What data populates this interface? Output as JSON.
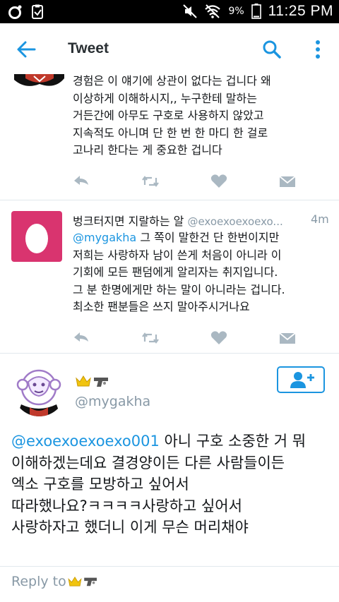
{
  "status_bar": {
    "battery_percent": "9%",
    "time": "11:25 PM"
  },
  "app_bar": {
    "title": "Tweet"
  },
  "tweet1": {
    "lines": [
      "경험은 이 얘기에 상관이 없다는 겁니다 왜",
      "이상하게 이해하시지,, 누구한테 말하는",
      "거든간에 아무도 구호로 사용하지 않았고",
      "지속적도 아니며 단 한 번 한 마디 한 걸로",
      "고나리 한다는 게 중요한 겁니다"
    ]
  },
  "tweet2": {
    "author_name": "벙크터지면 지랄하는 알",
    "author_handle": "@exoexoexoexo...",
    "time": "4m",
    "mention": "@mygakha",
    "line1_rest": " 그 쪽이 말한건 단 한번이지만",
    "lines": [
      "저희는 사랑하자 남이 쓴게 처음이 아니라 이",
      "기회에 모든 팬덤에게 알리자는 취지입니다.",
      "그 분 한명에게만 하는 말이 아니라는 겁니다.",
      "최소한 팬분들은 쓰지 말아주시거나요"
    ]
  },
  "main_tweet": {
    "handle": "@mygakha",
    "mention": "@exoexoexoexo001",
    "line1_rest": " 아니 구호 소중한 거 뭐",
    "lines": [
      "이해하겠는데요 결경양이든 다른 사람들이든",
      "엑소 구호를 모방하고 싶어서",
      "따라했나요?ㅋㅋㅋㅋ사랑하고 싶어서",
      "사랑하자고 했더니 이게 무슨 머리채야"
    ]
  },
  "reply": {
    "label": "Reply to"
  },
  "colors": {
    "accent": "#1b95e0",
    "egg_avatar": "#d9346f",
    "muted": "#8899a6",
    "like_active": "#ccd6dd"
  }
}
